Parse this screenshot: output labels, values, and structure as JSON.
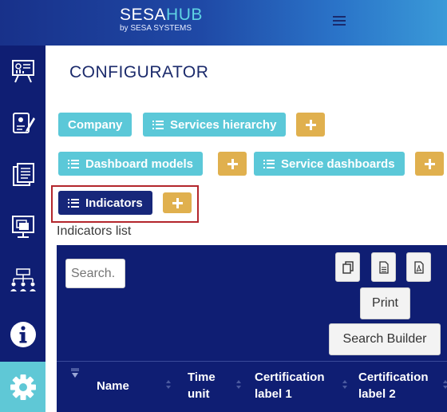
{
  "header": {
    "brand_prefix": "SESA",
    "brand_suffix": "HUB",
    "brand_sub": "by SESA SYSTEMS"
  },
  "sidebar": {
    "items": [
      {
        "icon": "presentation-dashboard-icon",
        "active": false
      },
      {
        "icon": "certificate-edit-icon",
        "active": false
      },
      {
        "icon": "documents-icon",
        "active": false
      },
      {
        "icon": "monitor-screen-icon",
        "active": false
      },
      {
        "icon": "hierarchy-icon",
        "active": false
      },
      {
        "icon": "info-icon",
        "active": false
      },
      {
        "icon": "gear-icon",
        "active": true
      }
    ]
  },
  "main": {
    "title": "CONFIGURATOR",
    "buttons": {
      "company": "Company",
      "services_hierarchy": "Services hierarchy",
      "dashboard_models": "Dashboard models",
      "service_dashboards": "Service dashboards",
      "indicators": "Indicators"
    },
    "list_label": "Indicators list",
    "table": {
      "search_placeholder": "Search.",
      "print_label": "Print",
      "search_builder_label": "Search Builder",
      "columns": [
        "Name",
        "Time unit",
        "Certification label 1",
        "Certification label 2"
      ]
    }
  },
  "colors": {
    "navy": "#0f1e73",
    "teal": "#5bc8d8",
    "gold": "#e0b04e",
    "highlight": "#b3262c"
  }
}
